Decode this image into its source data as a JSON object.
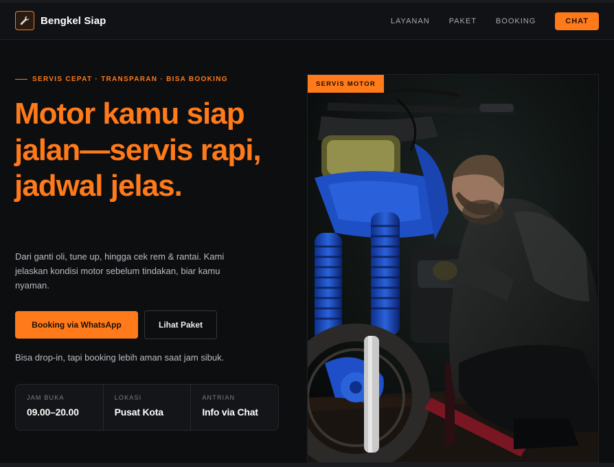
{
  "brand": {
    "name": "Bengkel Siap",
    "icon": "wrench-icon"
  },
  "nav": {
    "links": [
      "LAYANAN",
      "PAKET",
      "BOOKING"
    ],
    "cta": "CHAT"
  },
  "hero": {
    "eyebrow": "SERVIS CEPAT · TRANSPARAN · BISA BOOKING",
    "headline": "Motor kamu siap jalan—servis rapi, jadwal jelas.",
    "lead": "Dari ganti oli, tune up, hingga cek rem & rantai. Kami jelaskan kondisi motor sebelum tindakan, biar kamu nyaman.",
    "primary_button": "Booking via WhatsApp",
    "secondary_button": "Lihat Paket",
    "note": "Bisa drop-in, tapi booking lebih aman saat jam sibuk."
  },
  "stats": [
    {
      "label": "JAM BUKA",
      "value": "09.00–20.00"
    },
    {
      "label": "LOKASI",
      "value": "Pusat Kota"
    },
    {
      "label": "ANTRIAN",
      "value": "Info via Chat"
    }
  ],
  "photo": {
    "tag": "SERVIS MOTOR"
  },
  "colors": {
    "accent": "#ff7a1a",
    "background": "#0d0e10",
    "surface": "#141518"
  }
}
